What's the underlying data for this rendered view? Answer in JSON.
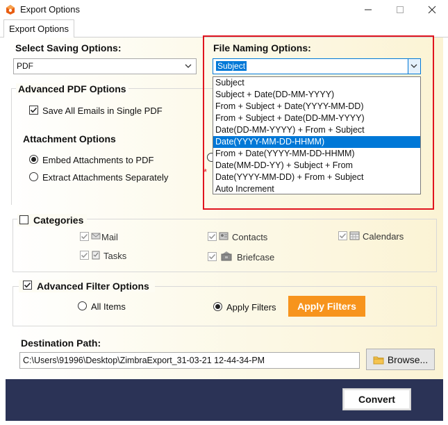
{
  "window": {
    "title": "Export Options"
  },
  "tabs": [
    {
      "label": "Export Options"
    }
  ],
  "saving": {
    "label": "Select Saving Options:",
    "selected": "PDF"
  },
  "naming": {
    "label": "File Naming Options:",
    "selected": "Subject",
    "options": [
      "Subject",
      "Subject + Date(DD-MM-YYYY)",
      "From + Subject + Date(YYYY-MM-DD)",
      "From + Subject + Date(DD-MM-YYYY)",
      "Date(DD-MM-YYYY) + From + Subject",
      "Date(YYYY-MM-DD-HHMM)",
      "From + Date(YYYY-MM-DD-HHMM)",
      "Date(MM-DD-YY) + Subject + From",
      "Date(YYYY-MM-DD) + From + Subject",
      "Auto Increment"
    ],
    "highlighted_index": 5
  },
  "advanced_pdf": {
    "title": "Advanced PDF Options",
    "save_single_label": "Save All Emails in Single PDF",
    "attachment_title": "Attachment Options",
    "embed_label": "Embed Attachments to PDF",
    "extract_label": "Extract Attachments Separately",
    "required_mark": "*"
  },
  "categories": {
    "title": "Categories",
    "mail": "Mail",
    "contacts": "Contacts",
    "calendars": "Calendars",
    "tasks": "Tasks",
    "briefcase": "Briefcase"
  },
  "filter": {
    "title": "Advanced Filter Options",
    "all_items": "All Items",
    "apply_filters_radio": "Apply Filters",
    "apply_filters_button": "Apply Filters"
  },
  "destination": {
    "label": "Destination Path:",
    "path": "C:\\Users\\91996\\Desktop\\ZimbraExport_31-03-21 12-44-34-PM",
    "browse": "Browse..."
  },
  "footer": {
    "convert": "Convert"
  },
  "colors": {
    "accent_orange": "#f7941d",
    "highlight_blue": "#0078d7",
    "footer_navy": "#2b3356",
    "frame_red": "#e0141e"
  }
}
